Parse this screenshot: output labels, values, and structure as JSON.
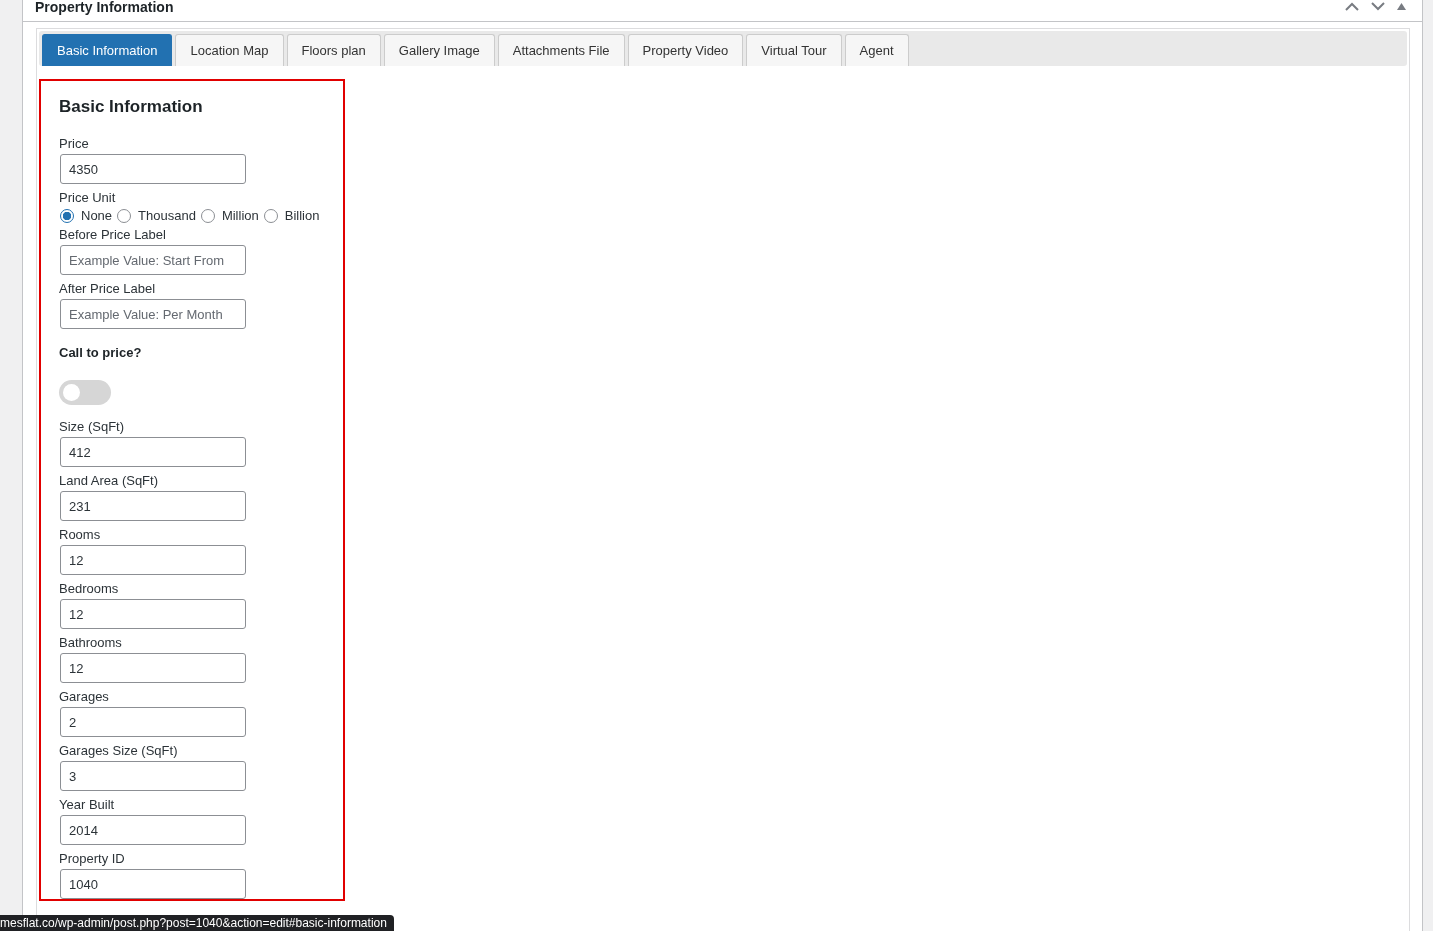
{
  "panel": {
    "title": "Property Information"
  },
  "tabs": [
    {
      "label": "Basic Information",
      "selected": true
    },
    {
      "label": "Location Map",
      "selected": false
    },
    {
      "label": "Floors plan",
      "selected": false
    },
    {
      "label": "Gallery Image",
      "selected": false
    },
    {
      "label": "Attachments File",
      "selected": false
    },
    {
      "label": "Property Video",
      "selected": false
    },
    {
      "label": "Virtual Tour",
      "selected": false
    },
    {
      "label": "Agent",
      "selected": false
    }
  ],
  "section": {
    "title": "Basic Information"
  },
  "fields": [
    {
      "kind": "text",
      "label": "Price",
      "value": "4350"
    },
    {
      "kind": "radio",
      "label": "Price Unit",
      "options": [
        {
          "label": "None",
          "selected": true
        },
        {
          "label": "Thousand",
          "selected": false
        },
        {
          "label": "Million",
          "selected": false
        },
        {
          "label": "Billion",
          "selected": false
        }
      ]
    },
    {
      "kind": "text",
      "label": "Before Price Label",
      "placeholder": "Example Value: Start From"
    },
    {
      "kind": "text",
      "label": "After Price Label",
      "placeholder": "Example Value: Per Month"
    },
    {
      "kind": "toggle",
      "label": "Call to price?",
      "on": false
    },
    {
      "kind": "text",
      "label": "Size (SqFt)",
      "value": "412"
    },
    {
      "kind": "text",
      "label": "Land Area (SqFt)",
      "value": "231"
    },
    {
      "kind": "text",
      "label": "Rooms",
      "value": "12"
    },
    {
      "kind": "text",
      "label": "Bedrooms",
      "value": "12"
    },
    {
      "kind": "text",
      "label": "Bathrooms",
      "value": "12"
    },
    {
      "kind": "text",
      "label": "Garages",
      "value": "2"
    },
    {
      "kind": "text",
      "label": "Garages Size (SqFt)",
      "value": "3"
    },
    {
      "kind": "text",
      "label": "Year Built",
      "value": "2014"
    },
    {
      "kind": "text",
      "label": "Property ID",
      "value": "1040"
    }
  ],
  "status_bar": {
    "url": "mesflat.co/wp-admin/post.php?post=1040&action=edit#basic-information"
  }
}
